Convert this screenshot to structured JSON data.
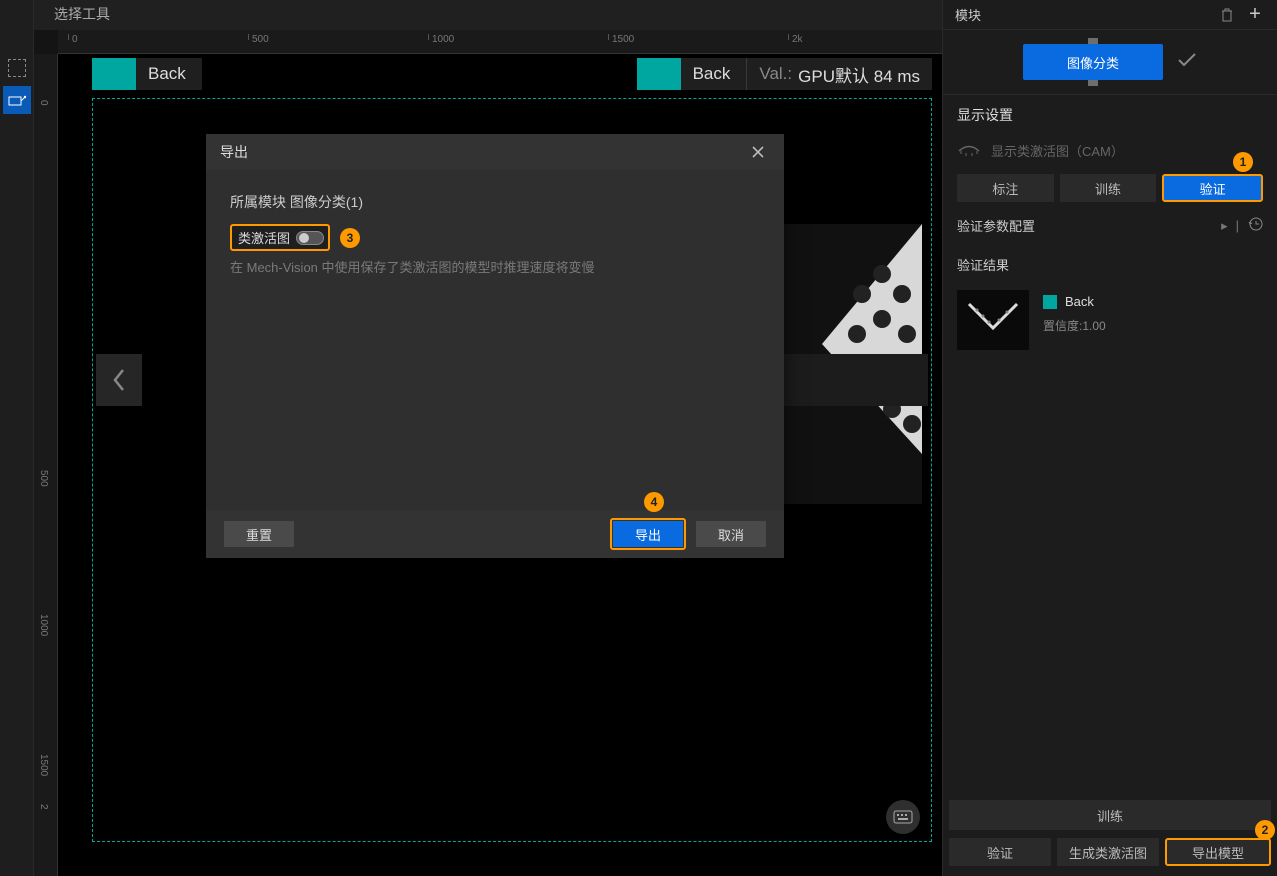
{
  "header": {
    "selectTool": "选择工具",
    "module": "模块"
  },
  "ruler": {
    "h": [
      "0",
      "500",
      "1000",
      "1500",
      "2k"
    ],
    "v": [
      "0",
      "500",
      "1000",
      "1500",
      "2"
    ]
  },
  "canvas": {
    "leftLabel": "Back",
    "rightLabel": "Back",
    "valPrefix": "Val.:",
    "valText": "GPU默认 84 ms"
  },
  "dialog": {
    "title": "导出",
    "section": "所属模块 图像分类(1)",
    "toggleLabel": "类激活图",
    "hint": "在 Mech-Vision 中使用保存了类激活图的模型时推理速度将变慢",
    "reset": "重置",
    "export": "导出",
    "cancel": "取消"
  },
  "right": {
    "moduleBtn": "图像分类",
    "displaySettings": "显示设置",
    "camLabel": "显示类激活图（CAM）",
    "tabs": {
      "label": "标注",
      "train": "训练",
      "verify": "验证"
    },
    "verifyCfg": "验证参数配置",
    "verifyResult": "验证结果",
    "resLabel": "Back",
    "conf": "置信度:1.00",
    "trainBtn": "训练",
    "bottom": {
      "verify": "验证",
      "gencam": "生成类激活图",
      "export": "导出模型"
    }
  },
  "anno": {
    "n1": "1",
    "n2": "2",
    "n3": "3",
    "n4": "4"
  }
}
